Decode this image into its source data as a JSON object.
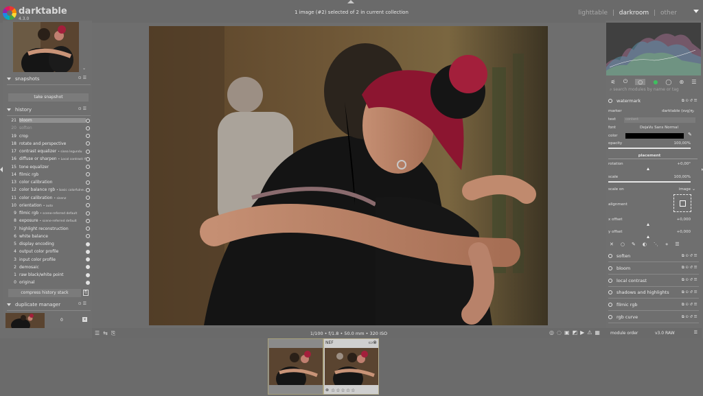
{
  "app": {
    "name": "darktable",
    "version": "4.3.0"
  },
  "header": {
    "collection_info": "1 image (#2) selected of 2 in current collection",
    "views": [
      "lighttable",
      "darkroom",
      "other"
    ],
    "active_view": "darkroom",
    "separator": "|"
  },
  "left": {
    "snapshots": {
      "title": "snapshots",
      "take_label": "take snapshot"
    },
    "history": {
      "title": "history",
      "items": [
        {
          "num": "21",
          "label": "bloom",
          "note": "",
          "state": "sel"
        },
        {
          "num": "20",
          "label": "soften",
          "note": "",
          "state": "dim"
        },
        {
          "num": "19",
          "label": "crop",
          "note": "",
          "state": ""
        },
        {
          "num": "18",
          "label": "rotate and perspective",
          "note": "",
          "state": ""
        },
        {
          "num": "17",
          "label": "contrast equalizer",
          "note": "• sisea legundu",
          "state": ""
        },
        {
          "num": "16",
          "label": "diffuse or sharpen",
          "note": "• Local contrast: fi...",
          "state": ""
        },
        {
          "num": "15",
          "label": "tone equalizer",
          "note": "",
          "state": ""
        },
        {
          "num": "14",
          "label": "filmic rgb",
          "note": "",
          "state": ""
        },
        {
          "num": "13",
          "label": "color calibration",
          "note": "",
          "state": ""
        },
        {
          "num": "12",
          "label": "color balance rgb",
          "note": "• basic colorfulne...",
          "state": ""
        },
        {
          "num": "11",
          "label": "color calibration",
          "note": "• sisenz",
          "state": ""
        },
        {
          "num": "10",
          "label": "orientation",
          "note": "• auto",
          "state": ""
        },
        {
          "num": "9",
          "label": "filmic rgb",
          "note": "• scene-referred default",
          "state": ""
        },
        {
          "num": "8",
          "label": "exposure",
          "note": "• scene-referred default",
          "state": ""
        },
        {
          "num": "7",
          "label": "highlight reconstruction",
          "note": "",
          "state": ""
        },
        {
          "num": "6",
          "label": "white balance",
          "note": "",
          "state": ""
        },
        {
          "num": "5",
          "label": "display encoding",
          "note": "",
          "state": "on"
        },
        {
          "num": "4",
          "label": "output color profile",
          "note": "",
          "state": "on"
        },
        {
          "num": "3",
          "label": "input color profile",
          "note": "",
          "state": "on"
        },
        {
          "num": "2",
          "label": "demosaic",
          "note": "",
          "state": "on"
        },
        {
          "num": "1",
          "label": "raw black/white point",
          "note": "",
          "state": "on"
        },
        {
          "num": "0",
          "label": "original",
          "note": "",
          "state": "on"
        }
      ],
      "compress_label": "compress history stack"
    },
    "duplicate_manager": {
      "title": "duplicate manager",
      "count": "0"
    }
  },
  "center": {
    "exif": "1/100 • f/1.8 • 50.0 mm • 320 ISO"
  },
  "right": {
    "search_placeholder": "search modules by name or tag",
    "watermark": {
      "title": "watermark",
      "marker_label": "marker",
      "marker_value": "darktable (svg)",
      "text_label": "text",
      "text_value": "content",
      "font_label": "font",
      "font_value": "DejaVu Sans Normal",
      "color_label": "color",
      "opacity_label": "opacity",
      "opacity_value": "100,00%",
      "placement_label": "placement",
      "rotation_label": "rotation",
      "rotation_value": "+0,00°",
      "scale_label": "scale",
      "scale_value": "100,00%",
      "scale_on_label": "scale on",
      "scale_on_value": "image",
      "alignment_label": "alignment",
      "xoffset_label": "x offset",
      "xoffset_value": "+0,000",
      "yoffset_label": "y offset",
      "yoffset_value": "+0,000"
    },
    "modules": [
      "soften",
      "bloom",
      "local contrast",
      "shadows and highlights",
      "filmic rgb",
      "rgb curve"
    ],
    "module_order_label": "module order",
    "module_order_value": "v3.0 RAW"
  },
  "filmstrip": {
    "format_tag": "NEF",
    "stars": "☆☆☆☆☆"
  }
}
